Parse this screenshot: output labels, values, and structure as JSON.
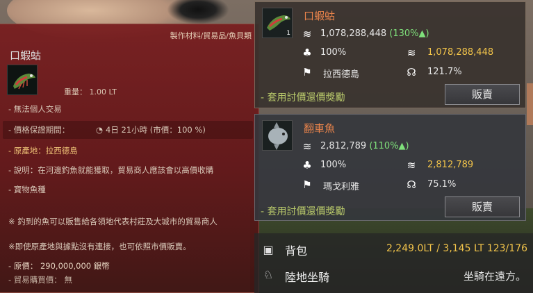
{
  "tooltip": {
    "category": "製作材料/貿易品/魚貝類",
    "item_name": "口蝦蛄",
    "weight": "重量： 1.00 LT",
    "lines": [
      "- 無法個人交易",
      "- 價格保證期間：",
      "4日 21小時 (市價：100 %)",
      "- 原產地：拉西德島",
      "- 說明：在河邊釣魚就能獲取，貿易商人應該會以高價收購",
      "- 寶物魚種",
      "※ 釣到的魚可以販售給各領地代表村莊及大城市的貿易商人",
      "※即使原產地與據點沒有連接，也可依照市價販賣。",
      "- 原價： 290,000,000 銀幣",
      "- 貿易購買價： 無"
    ]
  },
  "panels": [
    {
      "name": "口蝦蛄",
      "count": "1",
      "price": "1,078,288,448",
      "price_pct": "(130%▲)",
      "percent": "100%",
      "sell_price": "1,078,288,448",
      "origin": "拉西德島",
      "bonus": "121.7%",
      "apply_label": "- 套用討價還價獎勵",
      "sell_button": "販賣"
    },
    {
      "name": "翻車魚",
      "price": "2,812,789",
      "price_pct": "(110%▲)",
      "percent": "100%",
      "sell_price": "2,812,789",
      "origin": "瑪戈利雅",
      "bonus": "75.1%",
      "apply_label": "- 套用討價還價獎勵",
      "sell_button": "販賣"
    }
  ],
  "bottom": {
    "bag_label": "背包",
    "bag_weight": "2,249.0LT / 3,145 LT",
    "bag_slots": "123/176",
    "mount_label": "陸地坐騎",
    "mount_status": "坐騎在遠方。"
  },
  "colors": {
    "tooltip_bg": "#7a1c1e",
    "fish_name_orange": "#e8834b",
    "gold": "#f2c44a",
    "green_up": "#7fe07b",
    "apply_green": "#b9c96b"
  },
  "icons": [
    "coin-stack-icon",
    "bag-percent-icon",
    "coin-plus-icon",
    "flag-icon",
    "dragon-bonus-icon",
    "backpack-icon",
    "mount-icon",
    "clock-icon"
  ]
}
